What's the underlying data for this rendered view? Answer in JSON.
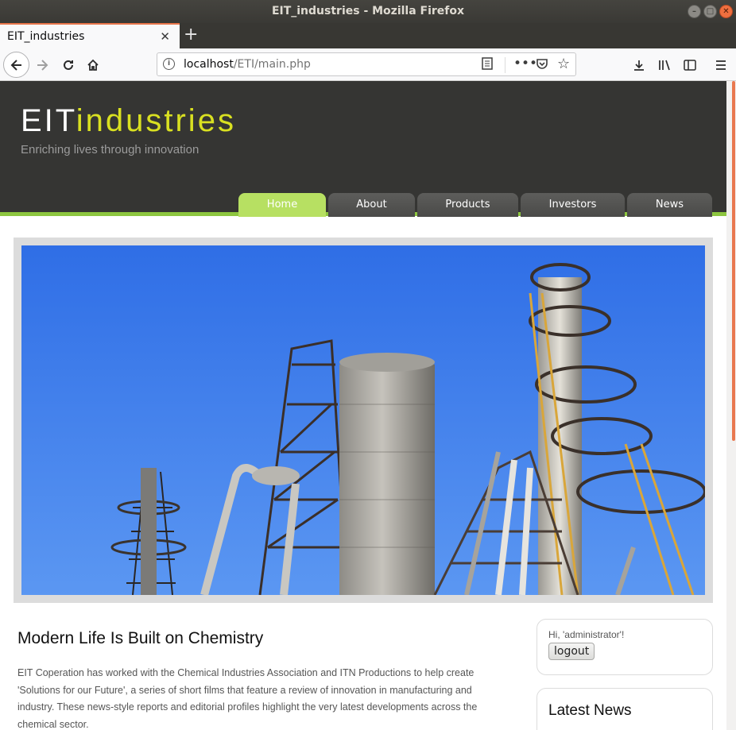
{
  "window": {
    "title": "EIT_industries - Mozilla Firefox"
  },
  "tab": {
    "title": "EIT_industries",
    "close": "✕",
    "new_tab": "+"
  },
  "urlbar": {
    "host": "localhost",
    "path": "/ETI/main.php"
  },
  "site": {
    "logo_part1": "EIT",
    "logo_part2": "industries",
    "slogan": "Enriching lives through innovation",
    "menu": [
      {
        "label": "Home",
        "active": true
      },
      {
        "label": "About",
        "active": false
      },
      {
        "label": "Products",
        "active": false
      },
      {
        "label": "Investors",
        "active": false
      },
      {
        "label": "News",
        "active": false
      }
    ]
  },
  "content": {
    "title": "Modern Life Is Built on Chemistry",
    "body": "EIT Coperation has worked with the Chemical Industries Association and ITN Productions to help create 'Solutions for our Future', a series of short films that feature a review of innovation in manufacturing and industry. These news-style reports and editorial profiles highlight the very latest developments across the chemical sector."
  },
  "sidebar": {
    "greeting": "Hi, 'administrator'!",
    "logout_label": "logout",
    "news_title": "Latest News"
  },
  "colors": {
    "accent_green": "#8dc63f",
    "logo_yellow": "#d9e021",
    "header_bg": "#353533"
  }
}
